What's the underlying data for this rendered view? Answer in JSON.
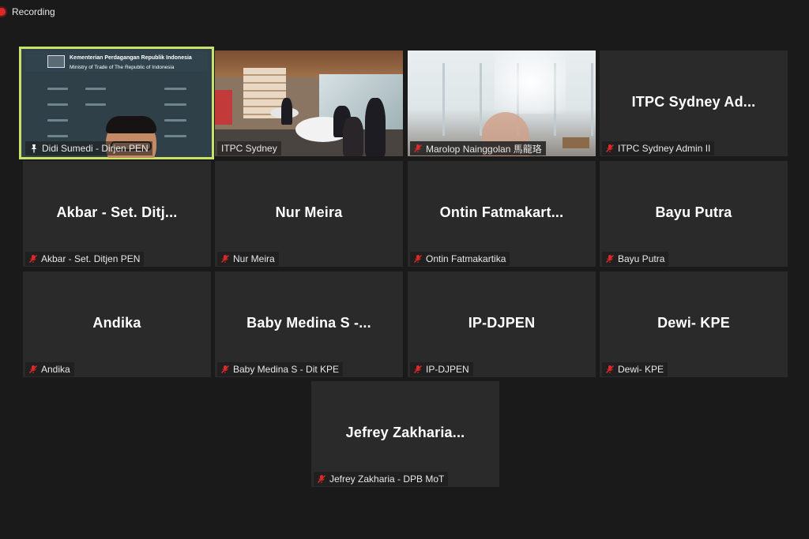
{
  "recording": {
    "label": "Recording"
  },
  "colors": {
    "active_speaker_border": "#c8e26a",
    "recording_dot": "#e02828",
    "muted_icon": "#e02828"
  },
  "tiles": [
    {
      "type": "video",
      "label": "Didi Sumedi - Dirjen PEN",
      "icon": "pin-icon",
      "active": true,
      "slide": {
        "org": "Kementerian Perdagangan Republik Indonesia",
        "org_en": "Ministry of Trade of The Republic of Indonesia"
      }
    },
    {
      "type": "video",
      "label": "ITPC Sydney",
      "icon": "none"
    },
    {
      "type": "video",
      "label": "Marolop Nainggolan 馬龍珞",
      "icon": "mic-muted-icon"
    },
    {
      "type": "avatar",
      "display": "ITPC Sydney Ad...",
      "label": "ITPC Sydney Admin II",
      "icon": "mic-muted-icon"
    },
    {
      "type": "avatar",
      "display": "Akbar - Set. Ditj...",
      "label": "Akbar - Set. Ditjen PEN",
      "icon": "mic-muted-icon"
    },
    {
      "type": "avatar",
      "display": "Nur Meira",
      "label": "Nur Meira",
      "icon": "mic-muted-icon"
    },
    {
      "type": "avatar",
      "display": "Ontin Fatmakart...",
      "label": "Ontin Fatmakartika",
      "icon": "mic-muted-icon"
    },
    {
      "type": "avatar",
      "display": "Bayu Putra",
      "label": "Bayu Putra",
      "icon": "mic-muted-icon"
    },
    {
      "type": "avatar",
      "display": "Andika",
      "label": "Andika",
      "icon": "mic-muted-icon"
    },
    {
      "type": "avatar",
      "display": "Baby Medina S -...",
      "label": "Baby Medina S - Dit KPE",
      "icon": "mic-muted-icon"
    },
    {
      "type": "avatar",
      "display": "IP-DJPEN",
      "label": "IP-DJPEN",
      "icon": "mic-muted-icon"
    },
    {
      "type": "avatar",
      "display": "Dewi- KPE",
      "label": "Dewi- KPE",
      "icon": "mic-muted-icon"
    },
    {
      "type": "avatar",
      "display": "Jefrey Zakharia...",
      "label": "Jefrey Zakharia - DPB MoT",
      "icon": "mic-muted-icon"
    }
  ]
}
